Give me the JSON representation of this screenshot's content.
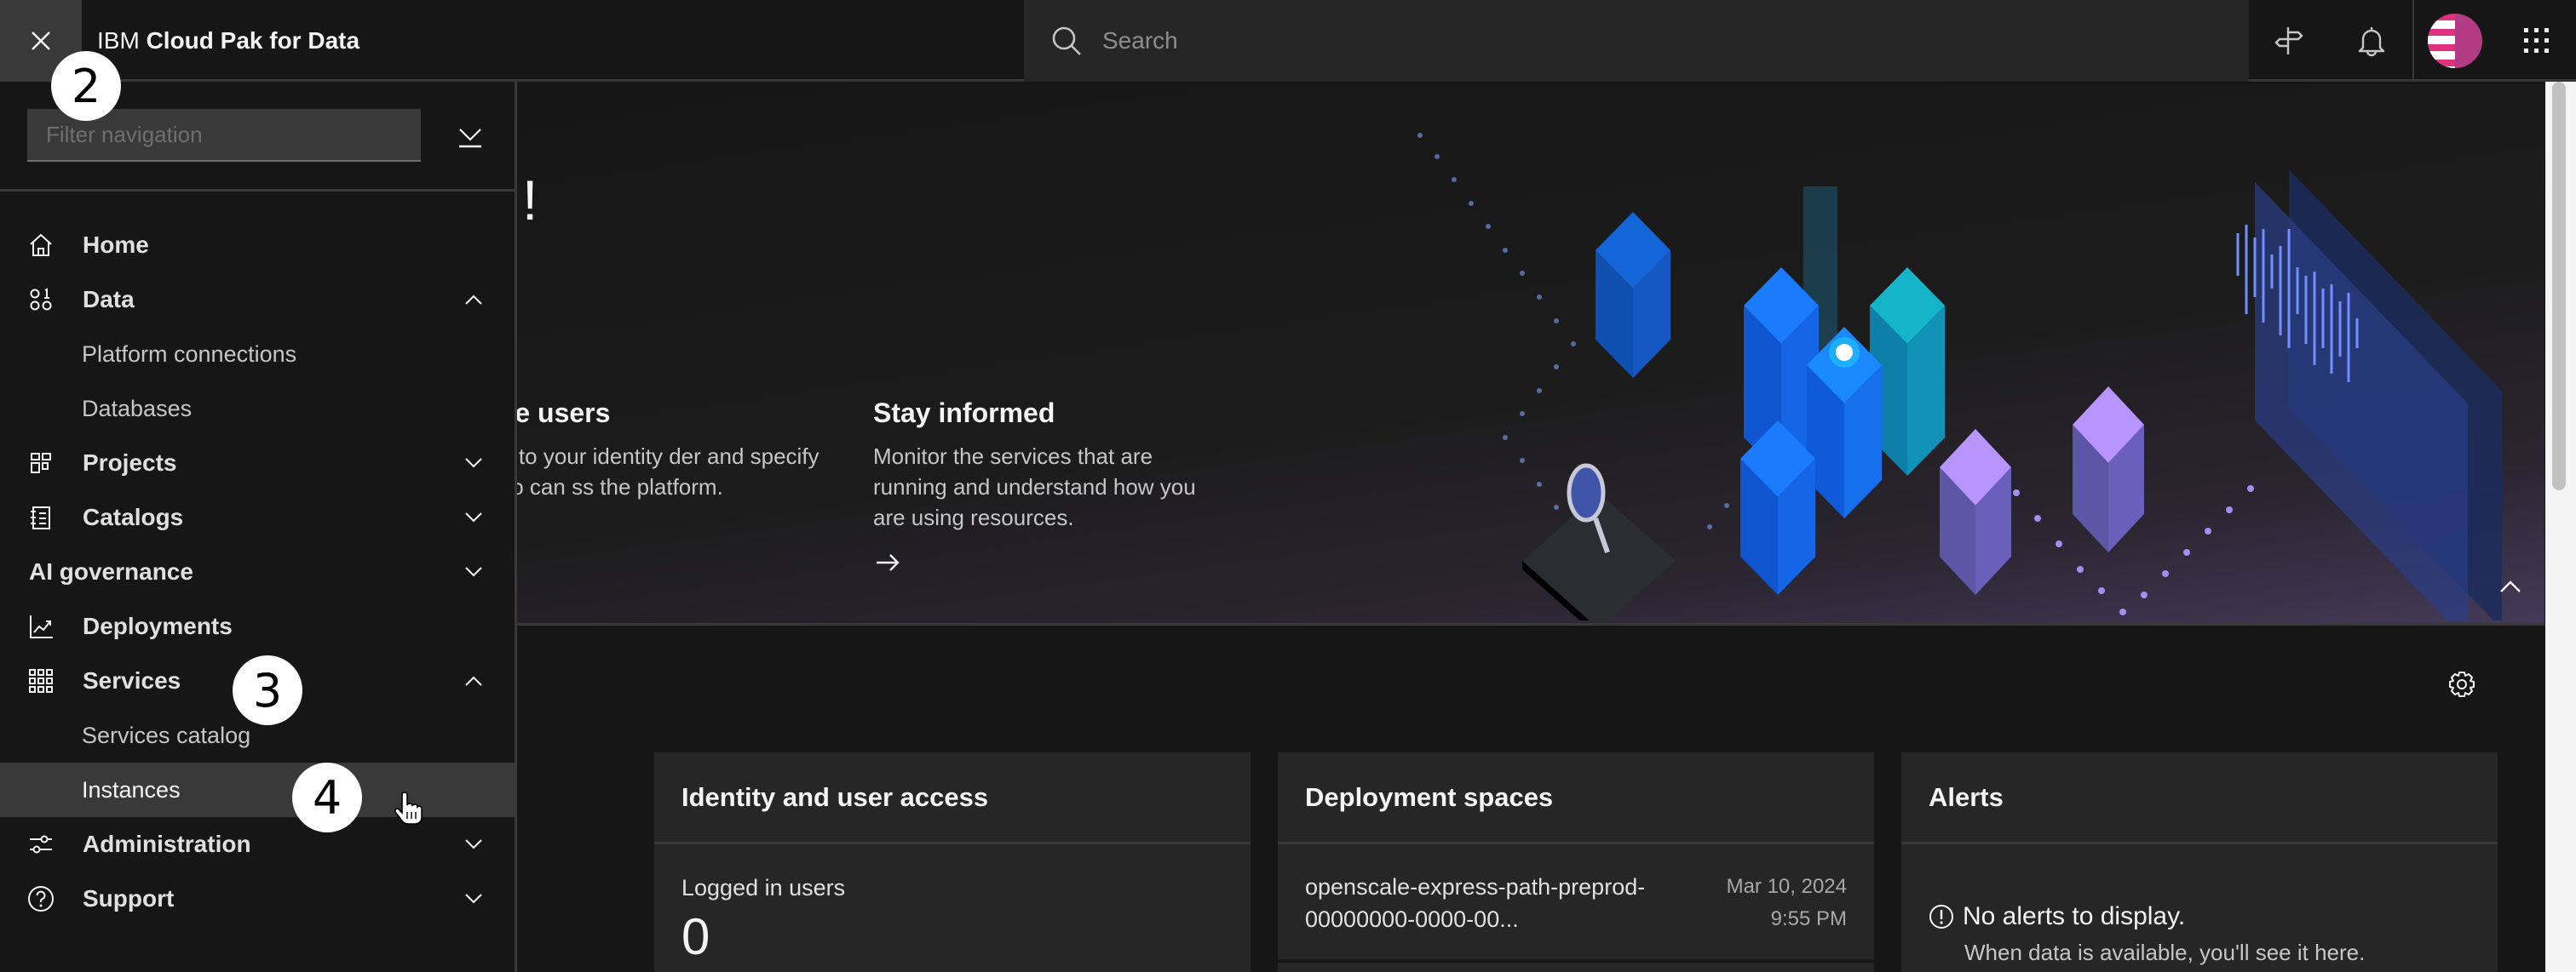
{
  "header": {
    "brand_prefix": "IBM",
    "brand_product": "Cloud Pak for Data",
    "search_placeholder": "Search",
    "icons": [
      "close-icon",
      "search-icon",
      "signpost-icon",
      "notification-bell-icon",
      "user-avatar",
      "app-switcher-icon"
    ]
  },
  "sidebar": {
    "filter_placeholder": "Filter navigation",
    "items": [
      {
        "label": "Home",
        "icon": "home-icon",
        "expandable": false
      },
      {
        "label": "Data",
        "icon": "data-icon",
        "expandable": true,
        "expanded": true,
        "children": [
          {
            "label": "Platform connections"
          },
          {
            "label": "Databases"
          }
        ]
      },
      {
        "label": "Projects",
        "icon": "projects-icon",
        "expandable": true,
        "expanded": false
      },
      {
        "label": "Catalogs",
        "icon": "catalog-icon",
        "expandable": true,
        "expanded": false
      },
      {
        "label": "AI governance",
        "icon": null,
        "expandable": true,
        "expanded": false
      },
      {
        "label": "Deployments",
        "icon": "chart-line-icon",
        "expandable": false
      },
      {
        "label": "Services",
        "icon": "services-grid-icon",
        "expandable": true,
        "expanded": true,
        "children": [
          {
            "label": "Services catalog"
          },
          {
            "label": "Instances",
            "active": true
          }
        ]
      },
      {
        "label": "Administration",
        "icon": "settings-adjust-icon",
        "expandable": true,
        "expanded": false
      },
      {
        "label": "Support",
        "icon": "help-icon",
        "expandable": true,
        "expanded": false
      }
    ]
  },
  "hero": {
    "title_fragment": "!",
    "columns": [
      {
        "title": "age users",
        "body": "ect to your identity der and specify who can ss the platform."
      },
      {
        "title": "Stay informed",
        "body": "Monitor the services that are running and understand how you are using resources."
      }
    ]
  },
  "cards": {
    "identity": {
      "title": "Identity and user access",
      "metric_label": "Logged in users",
      "metric_value": "0"
    },
    "deployment_spaces": {
      "title": "Deployment spaces",
      "rows": [
        {
          "name": "openscale-express-path-preprod-00000000-0000-00...",
          "date": "Mar 10, 2024",
          "time": "9:55 PM"
        }
      ]
    },
    "alerts": {
      "title": "Alerts",
      "empty_title": "No alerts to display.",
      "empty_body": "When data is available, you'll see it here."
    }
  },
  "annotations": [
    "2",
    "3",
    "4"
  ],
  "colors": {
    "avatar_primary": "#e0317f",
    "avatar_secondary": "#b23b83",
    "active_item_bg": "#393939"
  }
}
